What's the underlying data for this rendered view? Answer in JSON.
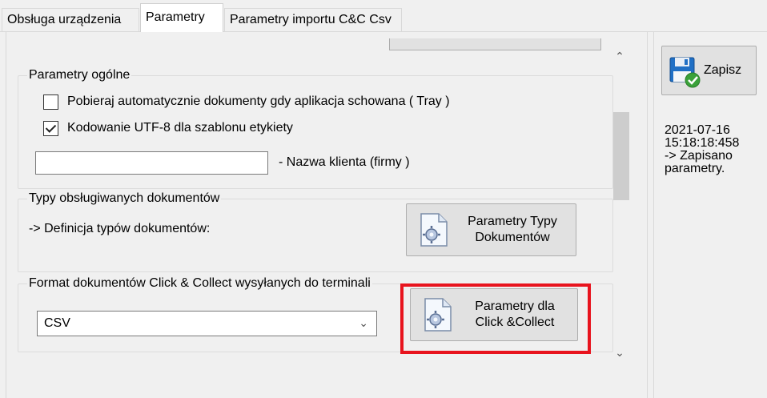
{
  "tabs": [
    {
      "label": "Obsługa urządzenia",
      "active": false
    },
    {
      "label": "Parametry",
      "active": true
    },
    {
      "label": "Parametry importu C&C Csv",
      "active": false
    }
  ],
  "general": {
    "title": "Parametry ogólne",
    "auto_download_label": "Pobieraj automatycznie dokumenty gdy aplikacja schowana ( Tray )",
    "auto_download_checked": false,
    "utf8_label": "Kodowanie UTF-8 dla szablonu etykiety",
    "utf8_checked": true,
    "client_name_value": "",
    "client_name_label": "- Nazwa klienta (firmy )"
  },
  "doc_types": {
    "title": "Typy obsługiwanych dokumentów",
    "definition_label": "-> Definicja typów dokumentów:",
    "button_line1": "Parametry Typy",
    "button_line2": "Dokumentów"
  },
  "click_collect": {
    "title": "Format dokumentów Click & Collect wysyłanych do terminali",
    "format_value": "CSV",
    "button_line1": "Parametry dla",
    "button_line2": "Click &Collect"
  },
  "sidebar": {
    "save_label": "Zapisz",
    "log": "2021-07-16\n15:18:18:458\n-> Zapisano\nparametry."
  },
  "colors": {
    "highlight": "#e8141e",
    "save_icon_blue": "#1f6fc5",
    "save_icon_green": "#3aa13a"
  },
  "icons": {
    "settings_doc": "settings-document-icon",
    "save": "floppy-save-icon",
    "scroll_up": "chevron-up-icon",
    "scroll_down": "chevron-down-icon",
    "dropdown": "chevron-down-icon"
  }
}
